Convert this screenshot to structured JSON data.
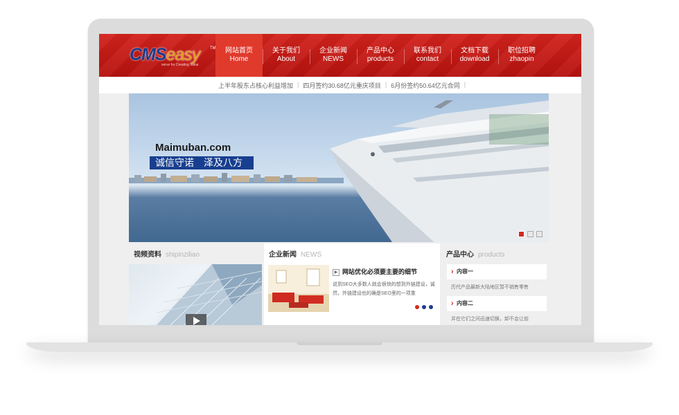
{
  "logo": {
    "cms": "CMS",
    "easy": "easy",
    "tm": "TM",
    "tagline": "serve for Creating Value"
  },
  "nav": [
    {
      "cn": "网站首页",
      "en": "Home"
    },
    {
      "cn": "关于我们",
      "en": "About"
    },
    {
      "cn": "企业新闻",
      "en": "NEWS"
    },
    {
      "cn": "产品中心",
      "en": "products"
    },
    {
      "cn": "联系我们",
      "en": "contact"
    },
    {
      "cn": "文档下载",
      "en": "download"
    },
    {
      "cn": "职位招聘",
      "en": "zhaopin"
    }
  ],
  "ticker": [
    "上半年股东占核心利益增加",
    "四月签约30.68亿元重庆项目",
    "6月份签约50.64亿元合同"
  ],
  "ticker_separator": "|",
  "banner": {
    "slogan": "Maimuban.com",
    "tag_left": "诚信守诺",
    "tag_right": "泽及八方",
    "active_slide_index": 0
  },
  "video": {
    "title": "视频资料",
    "title_en": "shipinziliao"
  },
  "news": {
    "title": "企业新闻",
    "title_en": "NEWS",
    "headline": "网站优化必须要主要的细节",
    "desc": "说到SEO大多数人就会很快的想到外链建设，诚然，外链建设也的确是SEO里的一项重"
  },
  "products": {
    "title": "产品中心",
    "title_en": "products",
    "items": [
      {
        "name": "内容一",
        "desc": "历代产品最新大陆地区暂不销售零售"
      },
      {
        "name": "内容二",
        "desc": "并在它们之间迅速切换，卸不会让前"
      }
    ]
  },
  "colors": {
    "header_red": "#c41a15",
    "nav_active": "#e03a2c",
    "banner_tag_blue": "#183f8f",
    "news_dot_red": "#d32a20",
    "news_dot_blue": "#1d3d8f"
  }
}
